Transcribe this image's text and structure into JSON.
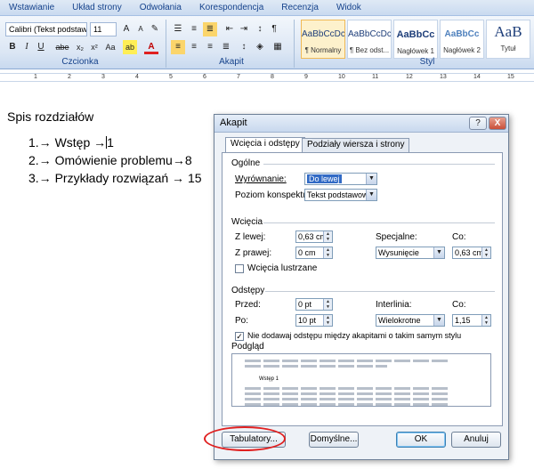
{
  "ribbon": {
    "tabs": [
      "Wstawianie",
      "Układ strony",
      "Odwołania",
      "Korespondencja",
      "Recenzja",
      "Widok"
    ],
    "font_name": "Calibri (Tekst podstawc",
    "font_size": "11",
    "groups": {
      "font": "Czcionka",
      "paragraph": "Akapit",
      "style": "Styl"
    },
    "styles": [
      {
        "preview": "AaBbCcDc",
        "name": "¶ Normalny"
      },
      {
        "preview": "AaBbCcDc",
        "name": "¶ Bez odst..."
      },
      {
        "preview": "AaBbCc",
        "name": "Nagłówek 1"
      },
      {
        "preview": "AaBbCc",
        "name": "Nagłówek 2"
      },
      {
        "preview": "AaB",
        "name": "Tytuł"
      }
    ],
    "buttons": {
      "bold": "B",
      "italic": "I",
      "underline": "U",
      "strike": "abe",
      "subscript": "x₂",
      "superscript": "x²",
      "case": "Aa",
      "highlight": "ab",
      "font_color": "A"
    }
  },
  "ruler": {
    "marks": [
      "1",
      "2",
      "3",
      "4",
      "5",
      "6",
      "7",
      "8",
      "9",
      "10",
      "11",
      "12",
      "13",
      "14",
      "15"
    ]
  },
  "document": {
    "title": "Spis rozdziałów",
    "toc": [
      {
        "text": "1.→ Wstęp →",
        "page": "1"
      },
      {
        "text": "2.→ Omówienie problemu→",
        "page": "8"
      },
      {
        "text": "3.→ Przykłady rozwiązań → ",
        "page": "15"
      }
    ]
  },
  "dialog": {
    "title": "Akapit",
    "help_label": "?",
    "close_label": "X",
    "tabs": [
      "Wcięcia i odstępy",
      "Podziały wiersza i strony"
    ],
    "general": {
      "heading": "Ogólne",
      "alignment_label": "Wyrównanie:",
      "alignment_value": "Do lewej",
      "outline_label": "Poziom konspektu:",
      "outline_value": "Tekst podstawowy"
    },
    "indent": {
      "heading": "Wcięcia",
      "left_label": "Z lewej:",
      "left_value": "0,63 cm",
      "right_label": "Z prawej:",
      "right_value": "0 cm",
      "special_label": "Specjalne:",
      "special_value": "Wysunięcie",
      "by_label": "Co:",
      "by_value": "0,63 cm",
      "mirror_label": "Wcięcia lustrzane"
    },
    "spacing": {
      "heading": "Odstępy",
      "before_label": "Przed:",
      "before_value": "0 pt",
      "after_label": "Po:",
      "after_value": "10 pt",
      "line_label": "Interlinia:",
      "line_value": "Wielokrotne",
      "at_label": "Co:",
      "at_value": "1,15",
      "no_space_label": "Nie dodawaj odstępu między akapitami o takim samym stylu",
      "no_space_checked": "✓"
    },
    "preview": {
      "heading": "Podgląd",
      "sample_text": "Wstęp         1"
    },
    "buttons": {
      "tabs": "Tabulatory...",
      "default": "Domyślne...",
      "ok": "OK",
      "cancel": "Anuluj"
    }
  },
  "colors": {
    "accent": "#316ac5",
    "annotation": "#e02020"
  }
}
